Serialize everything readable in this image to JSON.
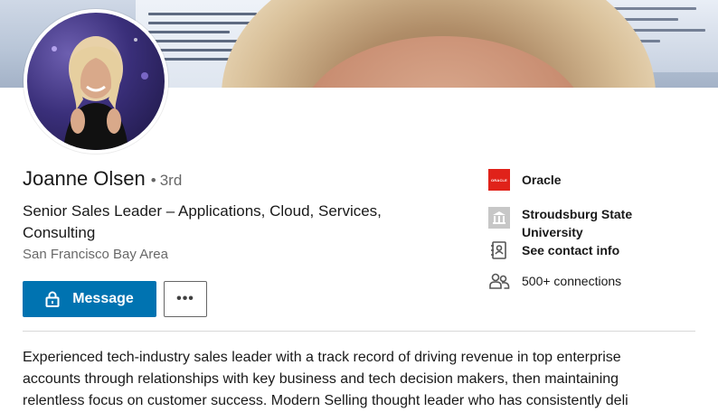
{
  "profile": {
    "name": "Joanne Olsen",
    "degree_separator": "•",
    "degree": "3rd",
    "headline_line1": "Senior Sales Leader – Applications, Cloud, Services,",
    "headline_line2": "Consulting",
    "location": "San Francisco Bay Area"
  },
  "actions": {
    "message_label": "Message",
    "more_label": "•••"
  },
  "sidebar": {
    "company": "Oracle",
    "company_logo_text": "ORACLE",
    "school_line1": "Stroudsburg State",
    "school_line2": "University",
    "contact_info": "See contact info",
    "connections": "500+ connections"
  },
  "summary": {
    "line1": "Experienced tech-industry sales leader with a track record of driving revenue in top enterprise",
    "line2": "accounts through relationships with key business and tech decision makers, then maintaining",
    "line3": "relentless focus on customer success. Modern Selling thought leader who has consistently deli"
  },
  "colors": {
    "primary_button": "#0073b1",
    "oracle_red": "#e0221a",
    "divider": "#d9d9d9"
  },
  "icons": [
    "lock-icon",
    "building-icon",
    "contact-card-icon",
    "people-icon"
  ]
}
